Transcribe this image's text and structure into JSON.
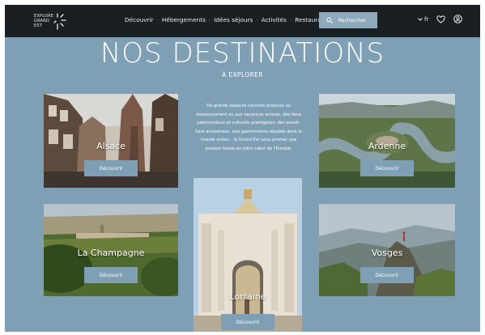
{
  "header": {
    "logo_lines": [
      "EXPLORE",
      "GRAND",
      "EST"
    ],
    "nav": [
      "Découvrir",
      "Hébergements",
      "Idées séjours",
      "Activités",
      "Restaurants"
    ],
    "search_label": "Rechercher",
    "lang": "fr"
  },
  "page": {
    "title": "NOS DESTINATIONS",
    "subtitle": "À EXPLORER"
  },
  "intro": "De grands espaces naturels propices au ressourcement ou aux vacances actives, des lieux patrimoniaux et culturels prestigieux, des savoir-faire ancestraux, une gastronomie réputée dans le monde entier... le Grand Est vous promet une évasion totale en plein cœur de l'Europe.",
  "destinations": [
    {
      "name": "Alsace",
      "cta": "Découvrir"
    },
    {
      "name": "Ardenne",
      "cta": "Découvrir"
    },
    {
      "name": "La Champagne",
      "cta": "Découvrir"
    },
    {
      "name": "Vosges",
      "cta": "Découvrir"
    },
    {
      "name": "Lorraine",
      "cta": "Découvrir"
    }
  ],
  "colors": {
    "header_bg": "#1a1f24",
    "page_bg": "#7f9fb5",
    "button_bg": "#7f9fb5",
    "search_bg": "#8fa9bc"
  },
  "icons": [
    "search-icon",
    "chevron-down-icon",
    "heart-icon",
    "user-icon"
  ]
}
